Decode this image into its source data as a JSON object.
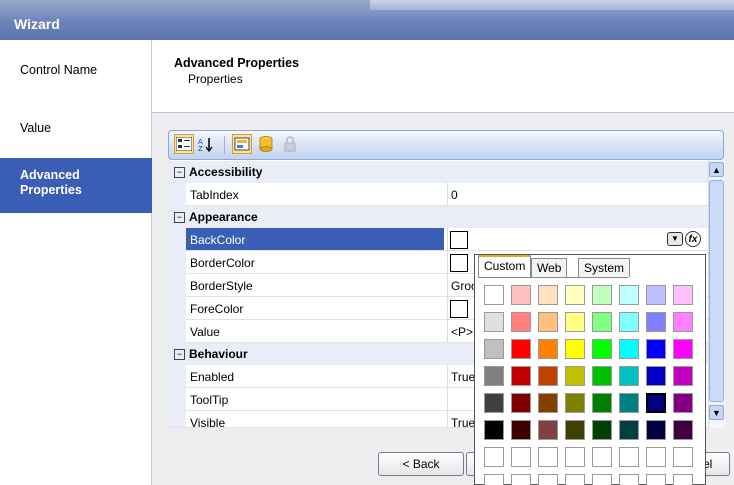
{
  "window": {
    "title": "Wizard"
  },
  "nav": {
    "items": [
      {
        "label": "Control Name"
      },
      {
        "label": "Value"
      },
      {
        "label": "Advanced Properties",
        "line1": "Advanced",
        "line2": "Properties",
        "active": true
      }
    ]
  },
  "header": {
    "title": "Advanced Properties",
    "subtitle": "Properties"
  },
  "toolbar": {
    "buttons": [
      "categorized-icon",
      "alphabetical-icon",
      "property-pages-icon",
      "database-icon",
      "lock-icon"
    ]
  },
  "grid": {
    "categories": [
      {
        "label": "Accessibility",
        "toggle": "⊟"
      },
      {
        "label": "Appearance",
        "toggle": "⊟"
      },
      {
        "label": "Behaviour",
        "toggle": "⊟"
      }
    ],
    "rows": [
      {
        "name": "TabIndex",
        "value": "0"
      },
      {
        "name": "BackColor",
        "value": ""
      },
      {
        "name": "BorderColor",
        "value": ""
      },
      {
        "name": "BorderStyle",
        "value": "Groo"
      },
      {
        "name": "ForeColor",
        "value": ""
      },
      {
        "name": "Value",
        "value": "<P>"
      },
      {
        "name": "Enabled",
        "value": "True"
      },
      {
        "name": "ToolTip",
        "value": ""
      },
      {
        "name": "Visible",
        "value": "True"
      }
    ]
  },
  "color_picker": {
    "tabs": [
      "Custom",
      "Web",
      "System"
    ],
    "active_tab": "Custom",
    "palette": [
      [
        "#ffffff",
        "#ffc0c0",
        "#ffe0c0",
        "#ffffc0",
        "#c0ffc0",
        "#c0ffff",
        "#c0c0ff",
        "#ffc0ff"
      ],
      [
        "#e0e0e0",
        "#ff8080",
        "#ffc080",
        "#ffff80",
        "#80ff80",
        "#80ffff",
        "#8080ff",
        "#ff80ff"
      ],
      [
        "#c0c0c0",
        "#ff0000",
        "#ff8000",
        "#ffff00",
        "#00ff00",
        "#00ffff",
        "#0000ff",
        "#ff00ff"
      ],
      [
        "#808080",
        "#c00000",
        "#c04000",
        "#c0c000",
        "#00c000",
        "#00c0c0",
        "#0000c0",
        "#c000c0"
      ],
      [
        "#404040",
        "#800000",
        "#804000",
        "#808000",
        "#008000",
        "#008080",
        "#000080",
        "#800080"
      ],
      [
        "#000000",
        "#400000",
        "#804040",
        "#404000",
        "#004000",
        "#004040",
        "#000040",
        "#400040"
      ],
      [
        "#ffffff",
        "#ffffff",
        "#ffffff",
        "#ffffff",
        "#ffffff",
        "#ffffff",
        "#ffffff",
        "#ffffff"
      ],
      [
        "#ffffff",
        "#ffffff",
        "#ffffff",
        "#ffffff",
        "#ffffff",
        "#ffffff",
        "#ffffff",
        "#ffffff"
      ]
    ],
    "selected": "#000080"
  },
  "buttons": {
    "back": "< Back",
    "cancel_partial": "el"
  },
  "colors": {
    "accent": "#3a5db5",
    "title_bar": "#6d83b9"
  }
}
